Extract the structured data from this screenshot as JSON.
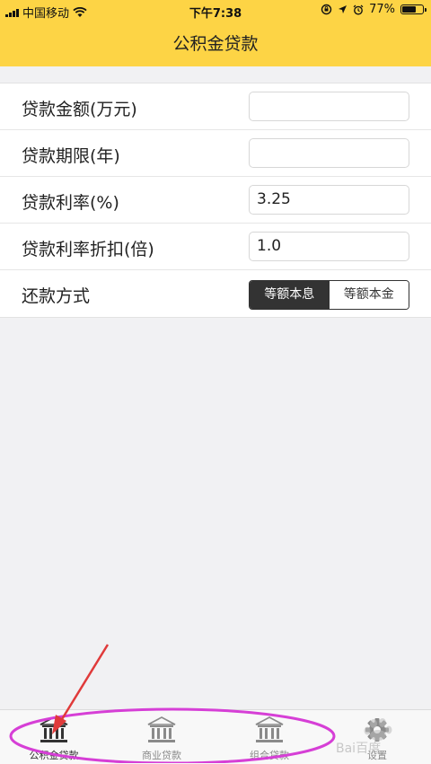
{
  "status_bar": {
    "carrier": "中国移动",
    "time": "下午7:38",
    "battery_percent": "77%",
    "battery_level": 0.77,
    "icons": [
      "signal-icon",
      "wifi-icon",
      "rotation-lock-icon",
      "location-icon",
      "alarm-icon",
      "battery-icon"
    ]
  },
  "header": {
    "title": "公积金贷款",
    "background_color": "#fdd445"
  },
  "form": {
    "rows": [
      {
        "label": "贷款金额(万元)",
        "value": "",
        "placeholder": ""
      },
      {
        "label": "贷款期限(年)",
        "value": "",
        "placeholder": ""
      },
      {
        "label": "贷款利率(%)",
        "value": "3.25",
        "placeholder": ""
      },
      {
        "label": "贷款利率折扣(倍)",
        "value": "1.0",
        "placeholder": ""
      }
    ],
    "repayment": {
      "label": "还款方式",
      "options": [
        "等额本息",
        "等额本金"
      ],
      "selected": "等额本息"
    }
  },
  "tabbar": {
    "tabs": [
      {
        "label": "公积金贷款",
        "icon": "bank-icon",
        "active": true
      },
      {
        "label": "商业贷款",
        "icon": "bank-icon",
        "active": false
      },
      {
        "label": "组合贷款",
        "icon": "bank-icon",
        "active": false
      },
      {
        "label": "设置",
        "icon": "gear-icon",
        "active": false
      }
    ]
  },
  "annotation": {
    "color": "#e0207a",
    "ellipse_color": "#d63fd6",
    "arrow_color": "#e03a3a"
  },
  "watermark": {
    "text": "Bai百度"
  }
}
